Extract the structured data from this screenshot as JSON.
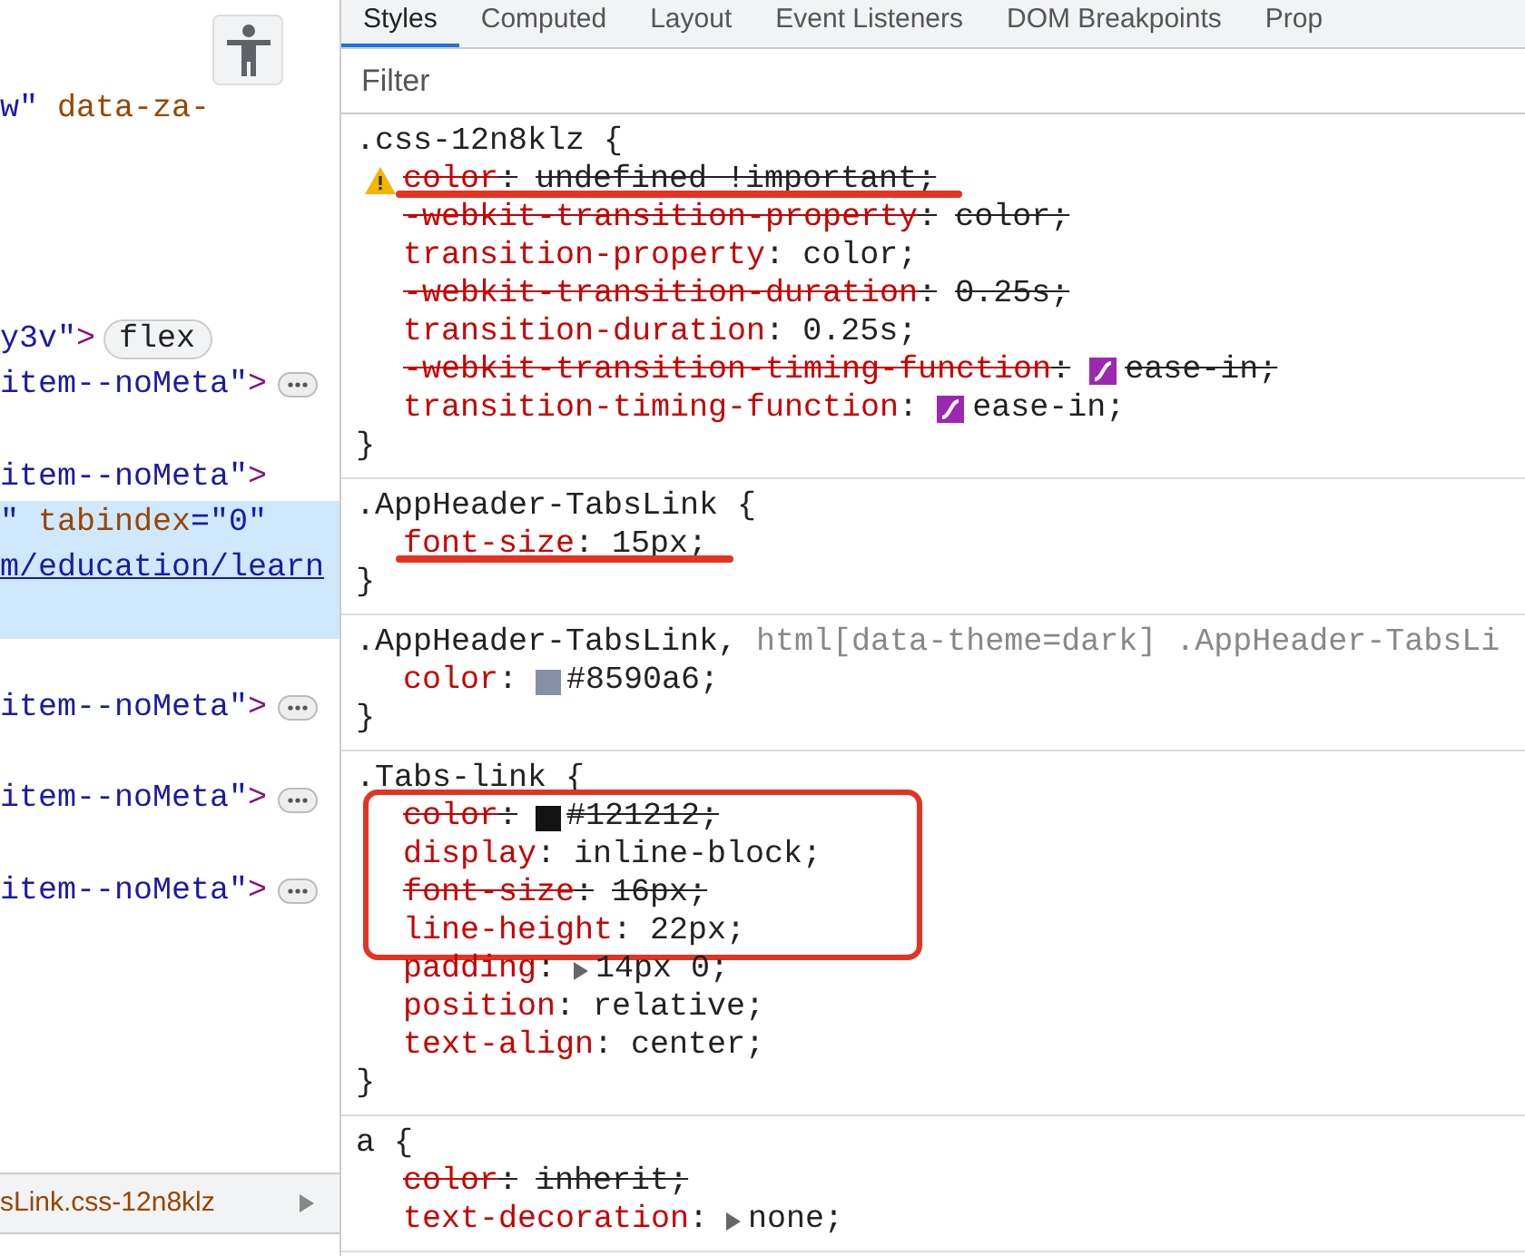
{
  "elements": {
    "lines": [
      {
        "kind": "node",
        "selected": false,
        "segments": [
          {
            "kind": "value",
            "text": "w\""
          },
          {
            "kind": "attr",
            "text": " data-za-"
          }
        ]
      },
      {
        "kind": "blank",
        "selected": false
      },
      {
        "kind": "blank",
        "selected": false
      },
      {
        "kind": "blank",
        "selected": false
      },
      {
        "kind": "blank",
        "selected": false
      },
      {
        "kind": "node",
        "selected": false,
        "segments": [
          {
            "kind": "value",
            "text": "y3v\""
          },
          {
            "kind": "tag",
            "text": ">"
          },
          {
            "kind": "badge",
            "text": "flex"
          }
        ]
      },
      {
        "kind": "node",
        "selected": false,
        "segments": [
          {
            "kind": "value",
            "text": "item--noMeta\""
          },
          {
            "kind": "tag",
            "text": ">"
          },
          {
            "kind": "more"
          }
        ]
      },
      {
        "kind": "blank",
        "selected": false
      },
      {
        "kind": "node",
        "selected": false,
        "segments": [
          {
            "kind": "value",
            "text": "item--noMeta\""
          },
          {
            "kind": "tag",
            "text": ">"
          }
        ]
      },
      {
        "kind": "node",
        "selected": true,
        "segments": [
          {
            "kind": "value",
            "text": "\""
          },
          {
            "kind": "attr",
            "text": " tabindex"
          },
          {
            "kind": "value",
            "text": "=\"0\""
          }
        ]
      },
      {
        "kind": "node",
        "selected": true,
        "segments": [
          {
            "kind": "link",
            "text": "m/education/learn"
          }
        ]
      },
      {
        "kind": "blank",
        "selected": true
      },
      {
        "kind": "blank",
        "selected": false
      },
      {
        "kind": "node",
        "selected": false,
        "segments": [
          {
            "kind": "value",
            "text": "item--noMeta\""
          },
          {
            "kind": "tag",
            "text": ">"
          },
          {
            "kind": "more"
          }
        ]
      },
      {
        "kind": "blank",
        "selected": false
      },
      {
        "kind": "node",
        "selected": false,
        "segments": [
          {
            "kind": "value",
            "text": "item--noMeta\""
          },
          {
            "kind": "tag",
            "text": ">"
          },
          {
            "kind": "more"
          }
        ]
      },
      {
        "kind": "blank",
        "selected": false
      },
      {
        "kind": "node",
        "selected": false,
        "segments": [
          {
            "kind": "value",
            "text": "item--noMeta\""
          },
          {
            "kind": "tag",
            "text": ">"
          },
          {
            "kind": "more"
          }
        ]
      }
    ],
    "breadcrumb": "sLink.css-12n8klz"
  },
  "tabs": [
    {
      "label": "Styles",
      "selected": true
    },
    {
      "label": "Computed",
      "selected": false
    },
    {
      "label": "Layout",
      "selected": false
    },
    {
      "label": "Event Listeners",
      "selected": false
    },
    {
      "label": "DOM Breakpoints",
      "selected": false
    },
    {
      "label": "Prop",
      "selected": false
    }
  ],
  "filter": {
    "placeholder": "Filter"
  },
  "rules": [
    {
      "selectors": [
        {
          "text": ".css-12n8klz {",
          "matched": true
        }
      ],
      "properties": [
        {
          "kind": "plain",
          "name": "color",
          "colon": ":",
          "value": "undefined !important;",
          "overridden": true,
          "warning": true,
          "underlined": true
        },
        {
          "kind": "plain",
          "name": "-webkit-transition-property",
          "colon": ":",
          "value": "color;",
          "overridden": true
        },
        {
          "kind": "plain",
          "name": "transition-property",
          "colon": ":",
          "value": "color;",
          "overridden": false
        },
        {
          "kind": "plain",
          "name": "-webkit-transition-duration",
          "colon": ":",
          "value": "0.25s;",
          "overridden": true
        },
        {
          "kind": "plain",
          "name": "transition-duration",
          "colon": ":",
          "value": "0.25s;",
          "overridden": false
        },
        {
          "kind": "bezier",
          "name": "-webkit-transition-timing-function",
          "colon": ":",
          "value": "ease-in;",
          "overridden": true
        },
        {
          "kind": "bezier",
          "name": "transition-timing-function",
          "colon": ":",
          "value": "ease-in;",
          "overridden": false
        }
      ],
      "close": "}"
    },
    {
      "selectors": [
        {
          "text": ".AppHeader-TabsLink {",
          "matched": true
        }
      ],
      "properties": [
        {
          "kind": "plain",
          "name": "font-size",
          "colon": ":",
          "value": "15px;",
          "overridden": false,
          "underlined": true
        }
      ],
      "close": "}"
    },
    {
      "selectors": [
        {
          "text": ".AppHeader-TabsLink,",
          "matched": true
        },
        {
          "text": " html[data-theme=dark] .AppHeader-TabsLi",
          "matched": false
        }
      ],
      "properties": [
        {
          "kind": "swatch",
          "name": "color",
          "colon": ":",
          "value": "#8590a6;",
          "overridden": false,
          "color": "#8590a6"
        }
      ],
      "close": "}"
    },
    {
      "selectors": [
        {
          "text": ".Tabs-link {",
          "matched": true
        }
      ],
      "properties": [
        {
          "kind": "swatch",
          "name": "color",
          "colon": ":",
          "value": "#121212;",
          "overridden": true,
          "color": "#121212",
          "boxed": true
        },
        {
          "kind": "plain",
          "name": "display",
          "colon": ":",
          "value": "inline-block;",
          "overridden": false,
          "boxed": true
        },
        {
          "kind": "plain",
          "name": "font-size",
          "colon": ":",
          "value": "16px;",
          "overridden": true,
          "boxed": true
        },
        {
          "kind": "plain",
          "name": "line-height",
          "colon": ":",
          "value": "22px;",
          "overridden": false,
          "boxed": true
        },
        {
          "kind": "expand",
          "name": "padding",
          "colon": ":",
          "value": "14px 0;",
          "overridden": false
        },
        {
          "kind": "plain",
          "name": "position",
          "colon": ":",
          "value": "relative;",
          "overridden": false
        },
        {
          "kind": "plain",
          "name": "text-align",
          "colon": ":",
          "value": "center;",
          "overridden": false
        }
      ],
      "close": "}"
    },
    {
      "selectors": [
        {
          "text": "a {",
          "matched": true
        }
      ],
      "properties": [
        {
          "kind": "plain",
          "name": "color",
          "colon": ":",
          "value": "inherit;",
          "overridden": true
        },
        {
          "kind": "expand",
          "name": "text-decoration",
          "colon": ":",
          "value": "none;",
          "overridden": false
        }
      ]
    }
  ]
}
